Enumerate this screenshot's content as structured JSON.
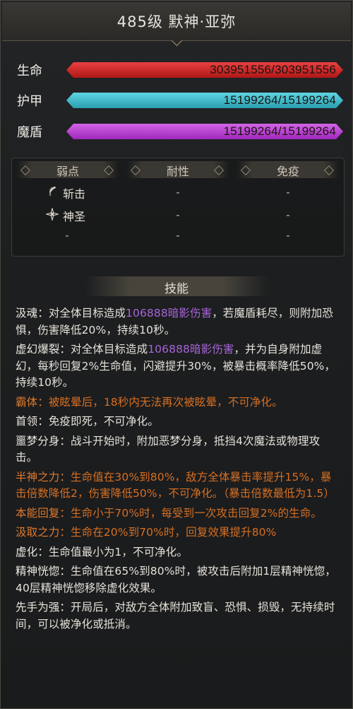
{
  "header": {
    "title": "485级  默神·亚弥"
  },
  "stats": [
    {
      "label": "生命",
      "value": "303951556/303951556",
      "fill": 1.0,
      "color": "#d12a2a"
    },
    {
      "label": "护甲",
      "value": "15199264/15199264",
      "fill": 1.0,
      "color": "#3bb8c8"
    },
    {
      "label": "魔盾",
      "value": "15199264/15199264",
      "fill": 1.0,
      "color": "#b63ad0"
    }
  ],
  "resistances": {
    "headers": [
      "弱点",
      "耐性",
      "免疫"
    ],
    "rows": [
      {
        "weak": "斩击",
        "weak_icon": "slash-icon",
        "resist": "-",
        "immune": "-"
      },
      {
        "weak": "神圣",
        "weak_icon": "holy-icon",
        "resist": "-",
        "immune": "-"
      },
      {
        "weak": "-",
        "resist": "-",
        "immune": "-"
      }
    ]
  },
  "skills_header": "技能",
  "skills": [
    {
      "name": "汲魂：",
      "pre": "对全体目标造成",
      "dmg": "106888暗影伤害",
      "post": "，若魔盾耗尽，则附加恐惧，伤害降低20%，持续10秒。",
      "color": "white"
    },
    {
      "name": "虚幻爆裂：",
      "pre": "对全体目标造成",
      "dmg": "106888暗影伤害",
      "post": "，并为自身附加虚幻，每秒回复2%生命值，闪避提升30%，被暴击概率降低50%，持续10秒。",
      "color": "white"
    },
    {
      "name": "霸体：",
      "pre": "被眩晕后，18秒内无法再次被眩晕，不可净化。",
      "dmg": "",
      "post": "",
      "color": "orange"
    },
    {
      "name": "首领：",
      "pre": "免疫即死，不可净化。",
      "dmg": "",
      "post": "",
      "color": "white"
    },
    {
      "name": "噩梦分身：",
      "pre": "战斗开始时，附加恶梦分身，抵挡4次魔法或物理攻击。",
      "dmg": "",
      "post": "",
      "color": "white"
    },
    {
      "name": "半神之力：",
      "pre": "生命值在30%到80%，敌方全体暴击率提升15%，暴击倍数降低2，伤害降低50%，不可净化。（暴击倍数最低为1.5）",
      "dmg": "",
      "post": "",
      "color": "orange"
    },
    {
      "name": "本能回复：",
      "pre": "生命小于70%时，每受到一次攻击回复2%的生命。",
      "dmg": "",
      "post": "",
      "color": "orange"
    },
    {
      "name": "汲取之力：",
      "pre": "生命在20%到70%时，回复效果提升80%",
      "dmg": "",
      "post": "",
      "color": "orange"
    },
    {
      "name": "虚化：",
      "pre": "生命值最小为1，不可净化。",
      "dmg": "",
      "post": "",
      "color": "white"
    },
    {
      "name": "精神恍惚：",
      "pre": "生命值在65%到80%时，被攻击后附加1层精神恍惚，40层精神恍惚移除虚化效果。",
      "dmg": "",
      "post": "",
      "color": "white"
    },
    {
      "name": "先手为强：",
      "pre": "开局后，对敌方全体附加致盲、恐惧、损毁，无持续时间，可以被净化或抵消。",
      "dmg": "",
      "post": "",
      "color": "white"
    }
  ]
}
